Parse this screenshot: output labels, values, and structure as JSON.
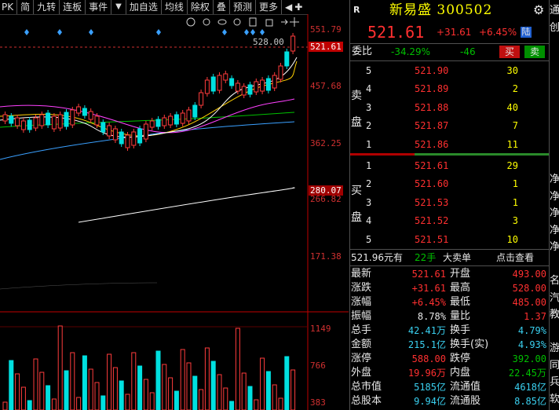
{
  "toolbar": {
    "items": [
      "PK",
      "简",
      "九转",
      "连板",
      "事件"
    ],
    "items2": [
      "加自选",
      "均线",
      "除权",
      "叠",
      "预测",
      "更多"
    ]
  },
  "chart": {
    "price_labels": [
      "551.79",
      "457.68",
      "362.25",
      "266.82",
      "171.38"
    ],
    "peak_label": "528.00",
    "current_box": "521.61",
    "ma_box": "280.07",
    "volume_labels": [
      "1149",
      "766",
      "383"
    ],
    "colors": {
      "up": "#ff3c3c",
      "down": "#00e0e0",
      "ma5": "#ffffff",
      "ma10": "#ffd000",
      "ma20": "#ff40ff",
      "ma30": "#00c000",
      "ma60": "#3aa0ff",
      "ma250": "#ffffff"
    }
  },
  "header": {
    "r_badge": "R",
    "title": "新易盛 300502",
    "price": "521.61",
    "change": "+31.61",
    "pct": "+6.45%",
    "market": "陆"
  },
  "weibi": {
    "label": "委比",
    "pct": "-34.29%",
    "diff": "-46",
    "buy_btn": "买",
    "sell_btn": "卖"
  },
  "sell": {
    "label_top": "卖",
    "label_bottom": "盘",
    "rows": [
      {
        "lvl": "5",
        "price": "521.90",
        "vol": "30"
      },
      {
        "lvl": "4",
        "price": "521.89",
        "vol": "2"
      },
      {
        "lvl": "3",
        "price": "521.88",
        "vol": "40"
      },
      {
        "lvl": "2",
        "price": "521.87",
        "vol": "7"
      },
      {
        "lvl": "1",
        "price": "521.86",
        "vol": "11"
      }
    ]
  },
  "buy": {
    "label_top": "买",
    "label_bottom": "盘",
    "rows": [
      {
        "lvl": "1",
        "price": "521.61",
        "vol": "29"
      },
      {
        "lvl": "2",
        "price": "521.60",
        "vol": "1"
      },
      {
        "lvl": "3",
        "price": "521.53",
        "vol": "1"
      },
      {
        "lvl": "4",
        "price": "521.52",
        "vol": "3"
      },
      {
        "lvl": "5",
        "price": "521.51",
        "vol": "10"
      }
    ]
  },
  "bigorder": {
    "price": "521.96元有",
    "hands": "22手",
    "label": "大卖单",
    "link": "点击查看"
  },
  "stats": [
    {
      "k1": "最新",
      "v1": "521.61",
      "c1": "red",
      "k2": "开盘",
      "v2": "493.00",
      "c2": "red"
    },
    {
      "k1": "涨跌",
      "v1": "+31.61",
      "c1": "red",
      "k2": "最高",
      "v2": "528.00",
      "c2": "red"
    },
    {
      "k1": "涨幅",
      "v1": "+6.45%",
      "c1": "red",
      "k2": "最低",
      "v2": "485.00",
      "c2": "red"
    },
    {
      "k1": "振幅",
      "v1": "8.78%",
      "c1": "white",
      "k2": "量比",
      "v2": "1.37",
      "c2": "red"
    },
    {
      "k1": "总手",
      "v1": "42.41万",
      "c1": "cyan",
      "k2": "换手",
      "v2": "4.79%",
      "c2": "cyan"
    },
    {
      "k1": "金额",
      "v1": "215.1亿",
      "c1": "cyan",
      "k2": "换手(实)",
      "v2": "4.93%",
      "c2": "cyan"
    },
    {
      "k1": "涨停",
      "v1": "588.00",
      "c1": "red",
      "k2": "跌停",
      "v2": "392.00",
      "c2": "green"
    },
    {
      "k1": "外盘",
      "v1": "19.96万",
      "c1": "red",
      "k2": "内盘",
      "v2": "22.45万",
      "c2": "green"
    },
    {
      "k1": "总市值",
      "v1": "5185亿",
      "c1": "cyan",
      "k2": "流通值",
      "v2": "4618亿",
      "c2": "cyan"
    },
    {
      "k1": "总股本",
      "v1": "9.94亿",
      "c1": "cyan",
      "k2": "流通股",
      "v2": "8.85亿",
      "c2": "cyan"
    }
  ],
  "edge_chars": [
    "通",
    "创",
    "",
    "",
    "",
    "",
    "",
    "",
    "",
    "",
    "净",
    "净",
    "净",
    "净",
    "净",
    "",
    "名",
    "汽",
    "教",
    "",
    "游",
    "同",
    "兵",
    "软"
  ]
}
